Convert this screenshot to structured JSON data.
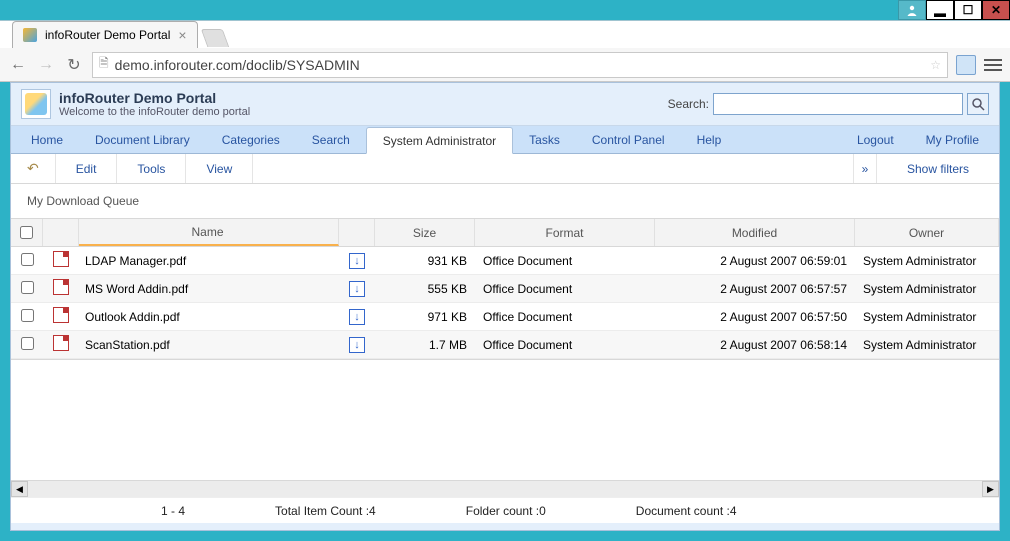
{
  "window": {
    "tab_title": "infoRouter Demo Portal",
    "url": "demo.inforouter.com/doclib/SYSADMIN"
  },
  "header": {
    "title": "infoRouter Demo Portal",
    "subtitle": "Welcome to the infoRouter demo portal",
    "search_label": "Search:"
  },
  "nav": {
    "home": "Home",
    "doclib": "Document Library",
    "categories": "Categories",
    "search": "Search",
    "sysadmin": "System Administrator",
    "tasks": "Tasks",
    "cpanel": "Control Panel",
    "help": "Help",
    "logout": "Logout",
    "profile": "My Profile"
  },
  "subnav": {
    "edit": "Edit",
    "tools": "Tools",
    "view": "View",
    "show_filters": "Show filters"
  },
  "queue": {
    "title": "My Download Queue",
    "columns": {
      "name": "Name",
      "size": "Size",
      "format": "Format",
      "modified": "Modified",
      "owner": "Owner"
    },
    "rows": [
      {
        "name": "LDAP Manager.pdf",
        "size": "931 KB",
        "format": "Office Document",
        "modified": "2 August 2007 06:59:01",
        "owner": "System Administrator"
      },
      {
        "name": "MS Word Addin.pdf",
        "size": "555 KB",
        "format": "Office Document",
        "modified": "2 August 2007 06:57:57",
        "owner": "System Administrator"
      },
      {
        "name": "Outlook Addin.pdf",
        "size": "971 KB",
        "format": "Office Document",
        "modified": "2 August 2007 06:57:50",
        "owner": "System Administrator"
      },
      {
        "name": "ScanStation.pdf",
        "size": "1.7 MB",
        "format": "Office Document",
        "modified": "2 August 2007 06:58:14",
        "owner": "System Administrator"
      }
    ]
  },
  "status": {
    "range": "1 - 4",
    "total": "Total Item Count :4",
    "folders": "Folder count :0",
    "docs": "Document count :4"
  }
}
